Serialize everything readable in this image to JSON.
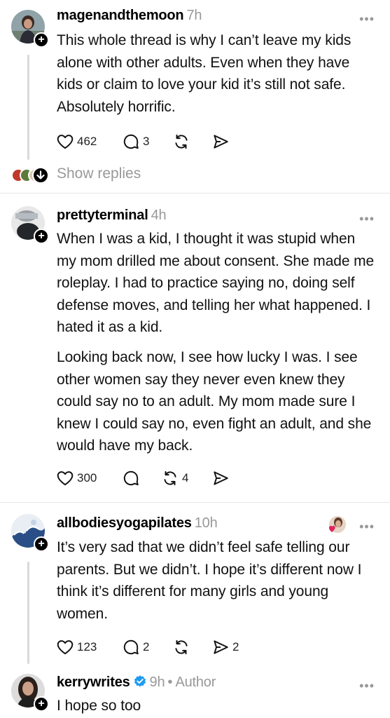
{
  "posts": [
    {
      "username": "magenandthemoon",
      "time": "7h",
      "text": [
        "This whole thread is why I can’t leave my kids alone with other adults. Even when they have kids or claim to love your kid it’s still not safe. Absolutely horrific."
      ],
      "likes": "462",
      "replies": "3",
      "reposts": "",
      "shares": ""
    },
    {
      "username": "prettyterminal",
      "time": "4h",
      "text": [
        "When I was a kid, I thought it was stupid when my mom drilled me about consent. She made me roleplay. I had to practice saying no, doing self defense moves, and telling her what happened. I hated it as a kid.",
        "Looking back now, I see how lucky I was. I see other women say they never even knew they could say no to an adult. My mom made sure I knew I could say no, even fight an adult, and she would have my back."
      ],
      "likes": "300",
      "replies": "",
      "reposts": "4",
      "shares": ""
    },
    {
      "username": "allbodiesyogapilates",
      "time": "10h",
      "text": [
        "It’s very sad that we didn’t feel safe telling our parents. But we didn’t. I hope it’s different now I think it’s different for many girls and young women."
      ],
      "likes": "123",
      "replies": "2",
      "reposts": "",
      "shares": "2"
    },
    {
      "username": "kerrywrites",
      "time": "9h",
      "author_tag": "• Author",
      "text": [
        "I hope so too"
      ]
    }
  ],
  "show_replies_label": "Show replies",
  "more_label": "•••",
  "follow_glyph": "+",
  "icons": [
    "heart-icon",
    "comment-icon",
    "repost-icon",
    "share-icon",
    "verified-icon",
    "more-icon"
  ],
  "colors": {
    "muted": "#999999",
    "verified": "#1d9bf0",
    "thread_line": "#d9d9d9"
  }
}
